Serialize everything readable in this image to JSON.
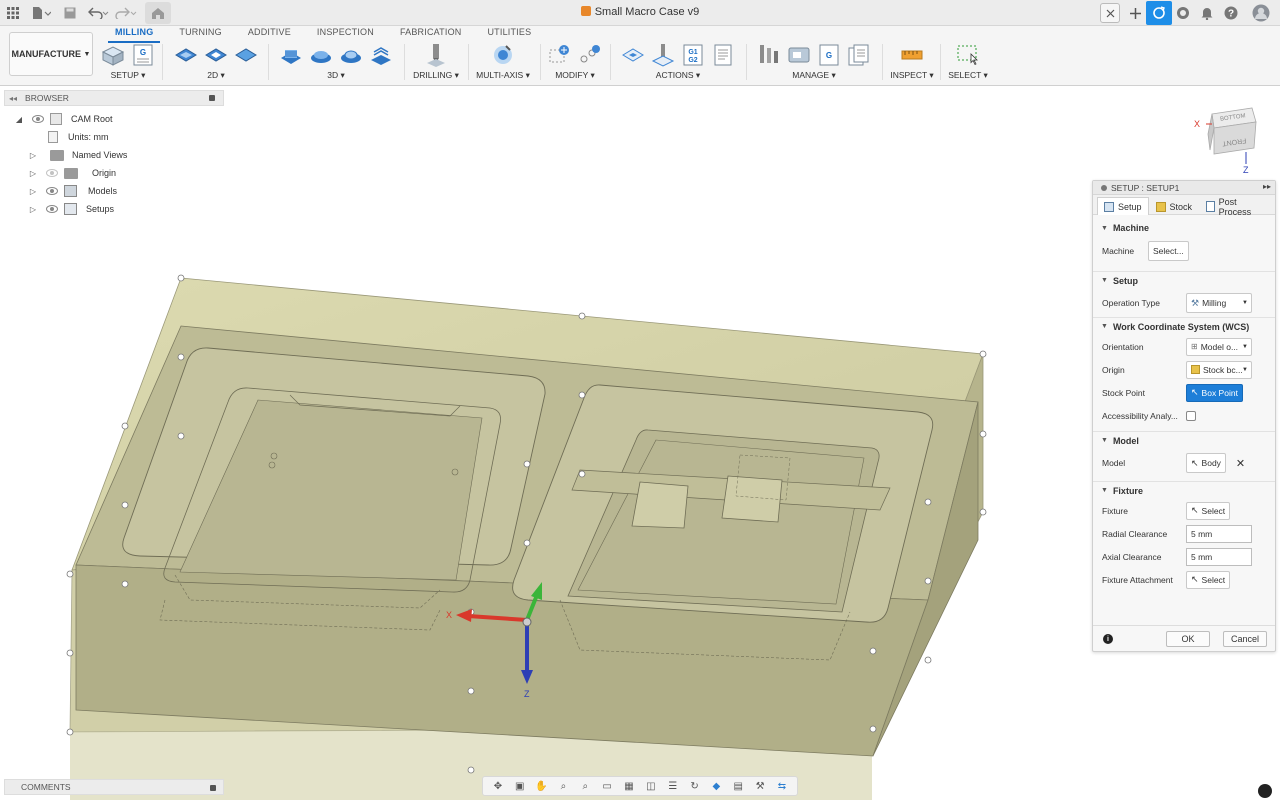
{
  "titlebar": {
    "document_title": "Small Macro Case v9",
    "icons": [
      "apps-grid-icon",
      "file-menu-icon",
      "save-icon",
      "undo-icon",
      "redo-icon",
      "home-icon",
      "close-tab-icon",
      "new-tab-icon",
      "sync-icon",
      "job-status-icon",
      "notifications-icon",
      "help-icon",
      "account-avatar-icon"
    ]
  },
  "ribbon": {
    "workspace_label": "MANUFACTURE",
    "tabs": [
      "MILLING",
      "TURNING",
      "ADDITIVE",
      "INSPECTION",
      "FABRICATION",
      "UTILITIES"
    ],
    "active_tab": "MILLING",
    "groups": {
      "setup": "SETUP",
      "twod": "2D",
      "threed": "3D",
      "drilling": "DRILLING",
      "multiaxis": "MULTI-AXIS",
      "modify": "MODIFY",
      "actions": "ACTIONS",
      "manage": "MANAGE",
      "inspect": "INSPECT",
      "select": "SELECT"
    },
    "actions_g_code": "G1 G2"
  },
  "browser": {
    "title": "BROWSER",
    "root": "CAM Root",
    "units": "Units: mm",
    "items": [
      "Named Views",
      "Origin",
      "Models",
      "Setups"
    ]
  },
  "comments": {
    "title": "COMMENTS"
  },
  "viewport": {
    "viewcube": {
      "top_face": "BOTTOM",
      "front_face": "FRONT",
      "x_axis": "X",
      "z_axis": "Z"
    },
    "triad": {
      "x_label": "X",
      "z_label": "Z"
    },
    "colors": {
      "stock_face": "#d2d0a6",
      "stock_side": "#bcbb8e",
      "triad_x": "#d9382b",
      "triad_y": "#3bb53a",
      "triad_z": "#2d3fb5"
    }
  },
  "setup_panel": {
    "title": "SETUP : SETUP1",
    "tabs": [
      "Setup",
      "Stock",
      "Post Process"
    ],
    "active_tab": "Setup",
    "sections": {
      "machine": {
        "title": "Machine",
        "machine_label": "Machine",
        "machine_button": "Select..."
      },
      "setup": {
        "title": "Setup",
        "operation_type_label": "Operation Type",
        "operation_type_value": "Milling"
      },
      "wcs": {
        "title": "Work Coordinate System (WCS)",
        "orientation_label": "Orientation",
        "orientation_value": "Model o...",
        "origin_label": "Origin",
        "origin_value": "Stock bc...",
        "stock_point_label": "Stock Point",
        "stock_point_value": "Box Point",
        "accessibility_label": "Accessibility Analy...",
        "accessibility_checked": false
      },
      "model": {
        "title": "Model",
        "model_label": "Model",
        "model_value": "Body"
      },
      "fixture": {
        "title": "Fixture",
        "fixture_label": "Fixture",
        "fixture_button": "Select",
        "radial_clearance_label": "Radial Clearance",
        "radial_clearance_value": "5 mm",
        "axial_clearance_label": "Axial Clearance",
        "axial_clearance_value": "5 mm",
        "fixture_attachment_label": "Fixture Attachment",
        "fixture_attachment_button": "Select"
      }
    },
    "ok_label": "OK",
    "cancel_label": "Cancel"
  },
  "navbar": {
    "icons": [
      "orbit-icon",
      "look-at-icon",
      "pan-icon",
      "zoom-icon",
      "zoom-window-icon",
      "display-settings-icon",
      "grid-icon",
      "viewports-icon",
      "section-icon",
      "free-orbit-icon",
      "visual-style-icon",
      "environment-icon",
      "effects-icon",
      "camera-icon"
    ]
  }
}
